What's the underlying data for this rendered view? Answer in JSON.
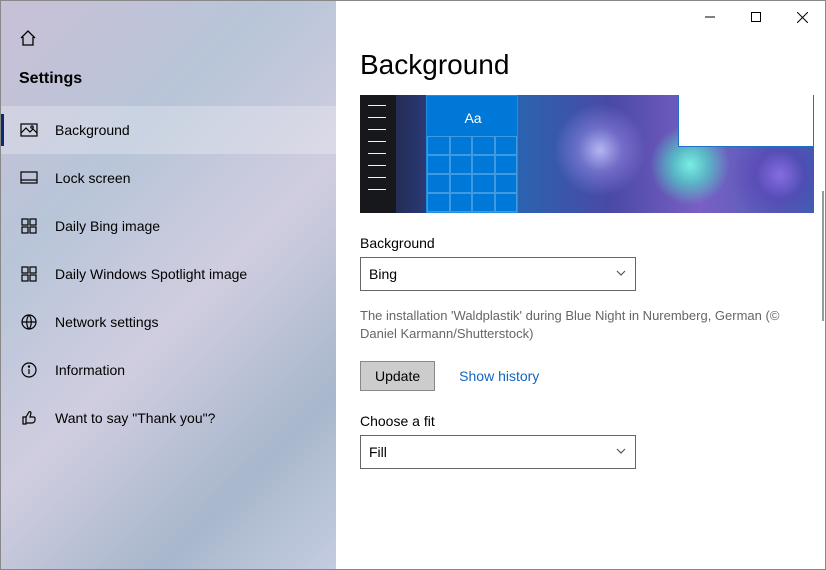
{
  "sidebar": {
    "title": "Settings",
    "items": [
      {
        "label": "Background"
      },
      {
        "label": "Lock screen"
      },
      {
        "label": "Daily Bing image"
      },
      {
        "label": "Daily Windows Spotlight image"
      },
      {
        "label": "Network settings"
      },
      {
        "label": "Information"
      },
      {
        "label": "Want to say \"Thank you\"?"
      }
    ]
  },
  "main": {
    "page_title": "Background",
    "preview_sample_text": "Aa",
    "background_label": "Background",
    "background_value": "Bing",
    "caption": "The installation 'Waldplastik' during Blue Night in Nuremberg, German (© Daniel Karmann/Shutterstock)",
    "update_label": "Update",
    "show_history_label": "Show history",
    "fit_label": "Choose a fit",
    "fit_value": "Fill"
  }
}
